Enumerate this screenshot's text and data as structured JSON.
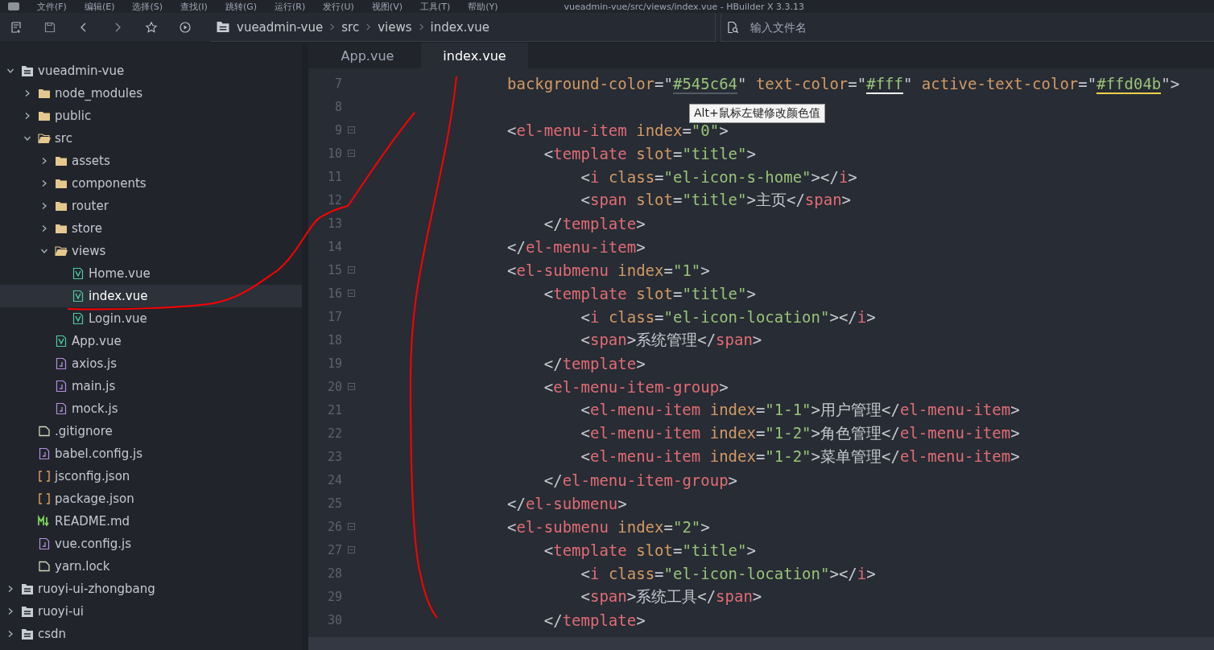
{
  "menu": [
    "文件(F)",
    "编辑(E)",
    "选择(S)",
    "查找(I)",
    "跳转(G)",
    "运行(R)",
    "发行(U)",
    "视图(V)",
    "工具(T)",
    "帮助(Y)"
  ],
  "window": {
    "title": "vueadmin-vue/src/views/index.vue - HBuilder X 3.3.13"
  },
  "toolbar": {
    "breadcrumb": [
      "vueadmin-vue",
      "src",
      "views",
      "index.vue"
    ],
    "search": {
      "placeholder": "输入文件名"
    }
  },
  "sidebar": {
    "items": [
      {
        "label": "vueadmin-vue",
        "kind": "project",
        "expanded": true,
        "selected": false,
        "children": [
          {
            "label": "node_modules",
            "kind": "folder",
            "expanded": false,
            "selected": false
          },
          {
            "label": "public",
            "kind": "folder",
            "expanded": false,
            "selected": false
          },
          {
            "label": "src",
            "kind": "folder",
            "expanded": true,
            "selected": false,
            "children": [
              {
                "label": "assets",
                "kind": "folder",
                "expanded": false,
                "selected": false
              },
              {
                "label": "components",
                "kind": "folder",
                "expanded": false,
                "selected": false
              },
              {
                "label": "router",
                "kind": "folder",
                "expanded": false,
                "selected": false
              },
              {
                "label": "store",
                "kind": "folder",
                "expanded": false,
                "selected": false
              },
              {
                "label": "views",
                "kind": "folder",
                "expanded": true,
                "selected": false,
                "children": [
                  {
                    "label": "Home.vue",
                    "kind": "vue",
                    "selected": false
                  },
                  {
                    "label": "index.vue",
                    "kind": "vue",
                    "selected": true
                  },
                  {
                    "label": "Login.vue",
                    "kind": "vue",
                    "selected": false
                  }
                ]
              },
              {
                "label": "App.vue",
                "kind": "vue",
                "selected": false
              },
              {
                "label": "axios.js",
                "kind": "js",
                "selected": false
              },
              {
                "label": "main.js",
                "kind": "js",
                "selected": false
              },
              {
                "label": "mock.js",
                "kind": "js",
                "selected": false
              }
            ]
          },
          {
            "label": ".gitignore",
            "kind": "file",
            "selected": false
          },
          {
            "label": "babel.config.js",
            "kind": "js",
            "selected": false
          },
          {
            "label": "jsconfig.json",
            "kind": "json",
            "selected": false
          },
          {
            "label": "package.json",
            "kind": "json",
            "selected": false
          },
          {
            "label": "README.md",
            "kind": "md",
            "selected": false
          },
          {
            "label": "vue.config.js",
            "kind": "js",
            "selected": false
          },
          {
            "label": "yarn.lock",
            "kind": "file",
            "selected": false
          }
        ]
      },
      {
        "label": "ruoyi-ui-zhongbang",
        "kind": "project",
        "expanded": false,
        "selected": false
      },
      {
        "label": "ruoyi-ui",
        "kind": "project",
        "expanded": false,
        "selected": false
      },
      {
        "label": "csdn",
        "kind": "project",
        "expanded": false,
        "selected": false
      }
    ]
  },
  "tabs": [
    {
      "label": "App.vue",
      "selected": false
    },
    {
      "label": "index.vue",
      "selected": true
    }
  ],
  "editor": {
    "tooltip": "Alt+鼠标左键修改颜色值",
    "lines": [
      {
        "number": "7",
        "fold": false,
        "tokens": [
          {
            "kind": "attr",
            "text": "                background-color"
          },
          {
            "kind": "p",
            "text": "=\""
          },
          {
            "kind": "str",
            "text": "#545c64",
            "color": "#545c64"
          },
          {
            "kind": "p",
            "text": "\" "
          },
          {
            "kind": "attr",
            "text": "text-color"
          },
          {
            "kind": "p",
            "text": "=\""
          },
          {
            "kind": "str",
            "text": "#fff",
            "color": "#ffffff"
          },
          {
            "kind": "p",
            "text": "\" "
          },
          {
            "kind": "attr",
            "text": "active-text-color"
          },
          {
            "kind": "p",
            "text": "=\""
          },
          {
            "kind": "str",
            "text": "#ffd04b",
            "color": "#ffd04b"
          },
          {
            "kind": "p",
            "text": "\">"
          }
        ]
      },
      {
        "number": "8",
        "fold": false
      },
      {
        "number": "9",
        "fold": true,
        "tokens": [
          {
            "kind": "p",
            "text": "                <"
          },
          {
            "kind": "tag",
            "text": "el-menu-item"
          },
          {
            "kind": "attr",
            "text": " index"
          },
          {
            "kind": "p",
            "text": "="
          },
          {
            "kind": "str",
            "text": "\"0\""
          },
          {
            "kind": "p",
            "text": ">"
          }
        ]
      },
      {
        "number": "10",
        "fold": true,
        "tokens": [
          {
            "kind": "p",
            "text": "                    <"
          },
          {
            "kind": "tag",
            "text": "template"
          },
          {
            "kind": "attr",
            "text": " slot"
          },
          {
            "kind": "p",
            "text": "="
          },
          {
            "kind": "str",
            "text": "\"title\""
          },
          {
            "kind": "p",
            "text": ">"
          }
        ]
      },
      {
        "number": "11",
        "fold": false,
        "tokens": [
          {
            "kind": "p",
            "text": "                        <"
          },
          {
            "kind": "tag",
            "text": "i"
          },
          {
            "kind": "attr",
            "text": " class"
          },
          {
            "kind": "p",
            "text": "="
          },
          {
            "kind": "str",
            "text": "\"el-icon-s-home\""
          },
          {
            "kind": "p",
            "text": "></"
          },
          {
            "kind": "tag",
            "text": "i"
          },
          {
            "kind": "p",
            "text": ">"
          }
        ]
      },
      {
        "number": "12",
        "fold": false,
        "tokens": [
          {
            "kind": "p",
            "text": "                        <"
          },
          {
            "kind": "tag",
            "text": "span"
          },
          {
            "kind": "attr",
            "text": " slot"
          },
          {
            "kind": "p",
            "text": "="
          },
          {
            "kind": "str",
            "text": "\"title\""
          },
          {
            "kind": "p",
            "text": ">"
          },
          {
            "kind": "text",
            "text": "主页"
          },
          {
            "kind": "p",
            "text": "</"
          },
          {
            "kind": "tag",
            "text": "span"
          },
          {
            "kind": "p",
            "text": ">"
          }
        ]
      },
      {
        "number": "13",
        "fold": false,
        "tokens": [
          {
            "kind": "p",
            "text": "                    </"
          },
          {
            "kind": "tag",
            "text": "template"
          },
          {
            "kind": "p",
            "text": ">"
          }
        ]
      },
      {
        "number": "14",
        "fold": false,
        "tokens": [
          {
            "kind": "p",
            "text": "                </"
          },
          {
            "kind": "tag",
            "text": "el-menu-item"
          },
          {
            "kind": "p",
            "text": ">"
          }
        ]
      },
      {
        "number": "15",
        "fold": true,
        "tokens": [
          {
            "kind": "p",
            "text": "                <"
          },
          {
            "kind": "tag",
            "text": "el-submenu"
          },
          {
            "kind": "attr",
            "text": " index"
          },
          {
            "kind": "p",
            "text": "="
          },
          {
            "kind": "str",
            "text": "\"1\""
          },
          {
            "kind": "p",
            "text": ">"
          }
        ]
      },
      {
        "number": "16",
        "fold": true,
        "tokens": [
          {
            "kind": "p",
            "text": "                    <"
          },
          {
            "kind": "tag",
            "text": "template"
          },
          {
            "kind": "attr",
            "text": " slot"
          },
          {
            "kind": "p",
            "text": "="
          },
          {
            "kind": "str",
            "text": "\"title\""
          },
          {
            "kind": "p",
            "text": ">"
          }
        ]
      },
      {
        "number": "17",
        "fold": false,
        "tokens": [
          {
            "kind": "p",
            "text": "                        <"
          },
          {
            "kind": "tag",
            "text": "i"
          },
          {
            "kind": "attr",
            "text": " class"
          },
          {
            "kind": "p",
            "text": "="
          },
          {
            "kind": "str",
            "text": "\"el-icon-location\""
          },
          {
            "kind": "p",
            "text": "></"
          },
          {
            "kind": "tag",
            "text": "i"
          },
          {
            "kind": "p",
            "text": ">"
          }
        ]
      },
      {
        "number": "18",
        "fold": false,
        "tokens": [
          {
            "kind": "p",
            "text": "                        <"
          },
          {
            "kind": "tag",
            "text": "span"
          },
          {
            "kind": "p",
            "text": ">"
          },
          {
            "kind": "text",
            "text": "系统管理"
          },
          {
            "kind": "p",
            "text": "</"
          },
          {
            "kind": "tag",
            "text": "span"
          },
          {
            "kind": "p",
            "text": ">"
          }
        ]
      },
      {
        "number": "19",
        "fold": false,
        "tokens": [
          {
            "kind": "p",
            "text": "                    </"
          },
          {
            "kind": "tag",
            "text": "template"
          },
          {
            "kind": "p",
            "text": ">"
          }
        ]
      },
      {
        "number": "20",
        "fold": true,
        "tokens": [
          {
            "kind": "p",
            "text": "                    <"
          },
          {
            "kind": "tag",
            "text": "el-menu-item-group"
          },
          {
            "kind": "p",
            "text": ">"
          }
        ]
      },
      {
        "number": "21",
        "fold": false,
        "tokens": [
          {
            "kind": "p",
            "text": "                        <"
          },
          {
            "kind": "tag",
            "text": "el-menu-item"
          },
          {
            "kind": "attr",
            "text": " index"
          },
          {
            "kind": "p",
            "text": "="
          },
          {
            "kind": "str",
            "text": "\"1-1\""
          },
          {
            "kind": "p",
            "text": ">"
          },
          {
            "kind": "text",
            "text": "用户管理"
          },
          {
            "kind": "p",
            "text": "</"
          },
          {
            "kind": "tag",
            "text": "el-menu-item"
          },
          {
            "kind": "p",
            "text": ">"
          }
        ]
      },
      {
        "number": "22",
        "fold": false,
        "tokens": [
          {
            "kind": "p",
            "text": "                        <"
          },
          {
            "kind": "tag",
            "text": "el-menu-item"
          },
          {
            "kind": "attr",
            "text": " index"
          },
          {
            "kind": "p",
            "text": "="
          },
          {
            "kind": "str",
            "text": "\"1-2\""
          },
          {
            "kind": "p",
            "text": ">"
          },
          {
            "kind": "text",
            "text": "角色管理"
          },
          {
            "kind": "p",
            "text": "</"
          },
          {
            "kind": "tag",
            "text": "el-menu-item"
          },
          {
            "kind": "p",
            "text": ">"
          }
        ]
      },
      {
        "number": "23",
        "fold": false,
        "tokens": [
          {
            "kind": "p",
            "text": "                        <"
          },
          {
            "kind": "tag",
            "text": "el-menu-item"
          },
          {
            "kind": "attr",
            "text": " index"
          },
          {
            "kind": "p",
            "text": "="
          },
          {
            "kind": "str",
            "text": "\"1-2\""
          },
          {
            "kind": "p",
            "text": ">"
          },
          {
            "kind": "text",
            "text": "菜单管理"
          },
          {
            "kind": "p",
            "text": "</"
          },
          {
            "kind": "tag",
            "text": "el-menu-item"
          },
          {
            "kind": "p",
            "text": ">"
          }
        ]
      },
      {
        "number": "24",
        "fold": false,
        "tokens": [
          {
            "kind": "p",
            "text": "                    </"
          },
          {
            "kind": "tag",
            "text": "el-menu-item-group"
          },
          {
            "kind": "p",
            "text": ">"
          }
        ]
      },
      {
        "number": "25",
        "fold": false,
        "tokens": [
          {
            "kind": "p",
            "text": "                </"
          },
          {
            "kind": "tag",
            "text": "el-submenu"
          },
          {
            "kind": "p",
            "text": ">"
          }
        ]
      },
      {
        "number": "26",
        "fold": true,
        "tokens": [
          {
            "kind": "p",
            "text": "                <"
          },
          {
            "kind": "tag",
            "text": "el-submenu"
          },
          {
            "kind": "attr",
            "text": " index"
          },
          {
            "kind": "p",
            "text": "="
          },
          {
            "kind": "str",
            "text": "\"2\""
          },
          {
            "kind": "p",
            "text": ">"
          }
        ]
      },
      {
        "number": "27",
        "fold": true,
        "tokens": [
          {
            "kind": "p",
            "text": "                    <"
          },
          {
            "kind": "tag",
            "text": "template"
          },
          {
            "kind": "attr",
            "text": " slot"
          },
          {
            "kind": "p",
            "text": "="
          },
          {
            "kind": "str",
            "text": "\"title\""
          },
          {
            "kind": "p",
            "text": ">"
          }
        ]
      },
      {
        "number": "28",
        "fold": false,
        "tokens": [
          {
            "kind": "p",
            "text": "                        <"
          },
          {
            "kind": "tag",
            "text": "i"
          },
          {
            "kind": "attr",
            "text": " class"
          },
          {
            "kind": "p",
            "text": "="
          },
          {
            "kind": "str",
            "text": "\"el-icon-location\""
          },
          {
            "kind": "p",
            "text": "></"
          },
          {
            "kind": "tag",
            "text": "i"
          },
          {
            "kind": "p",
            "text": ">"
          }
        ]
      },
      {
        "number": "29",
        "fold": false,
        "tokens": [
          {
            "kind": "p",
            "text": "                        <"
          },
          {
            "kind": "tag",
            "text": "span"
          },
          {
            "kind": "p",
            "text": ">"
          },
          {
            "kind": "text",
            "text": "系统工具"
          },
          {
            "kind": "p",
            "text": "</"
          },
          {
            "kind": "tag",
            "text": "span"
          },
          {
            "kind": "p",
            "text": ">"
          }
        ]
      },
      {
        "number": "30",
        "fold": false,
        "tokens": [
          {
            "kind": "p",
            "text": "                    </"
          },
          {
            "kind": "tag",
            "text": "template"
          },
          {
            "kind": "p",
            "text": ">"
          }
        ]
      }
    ]
  },
  "markup": {
    "kind": "freehand"
  }
}
